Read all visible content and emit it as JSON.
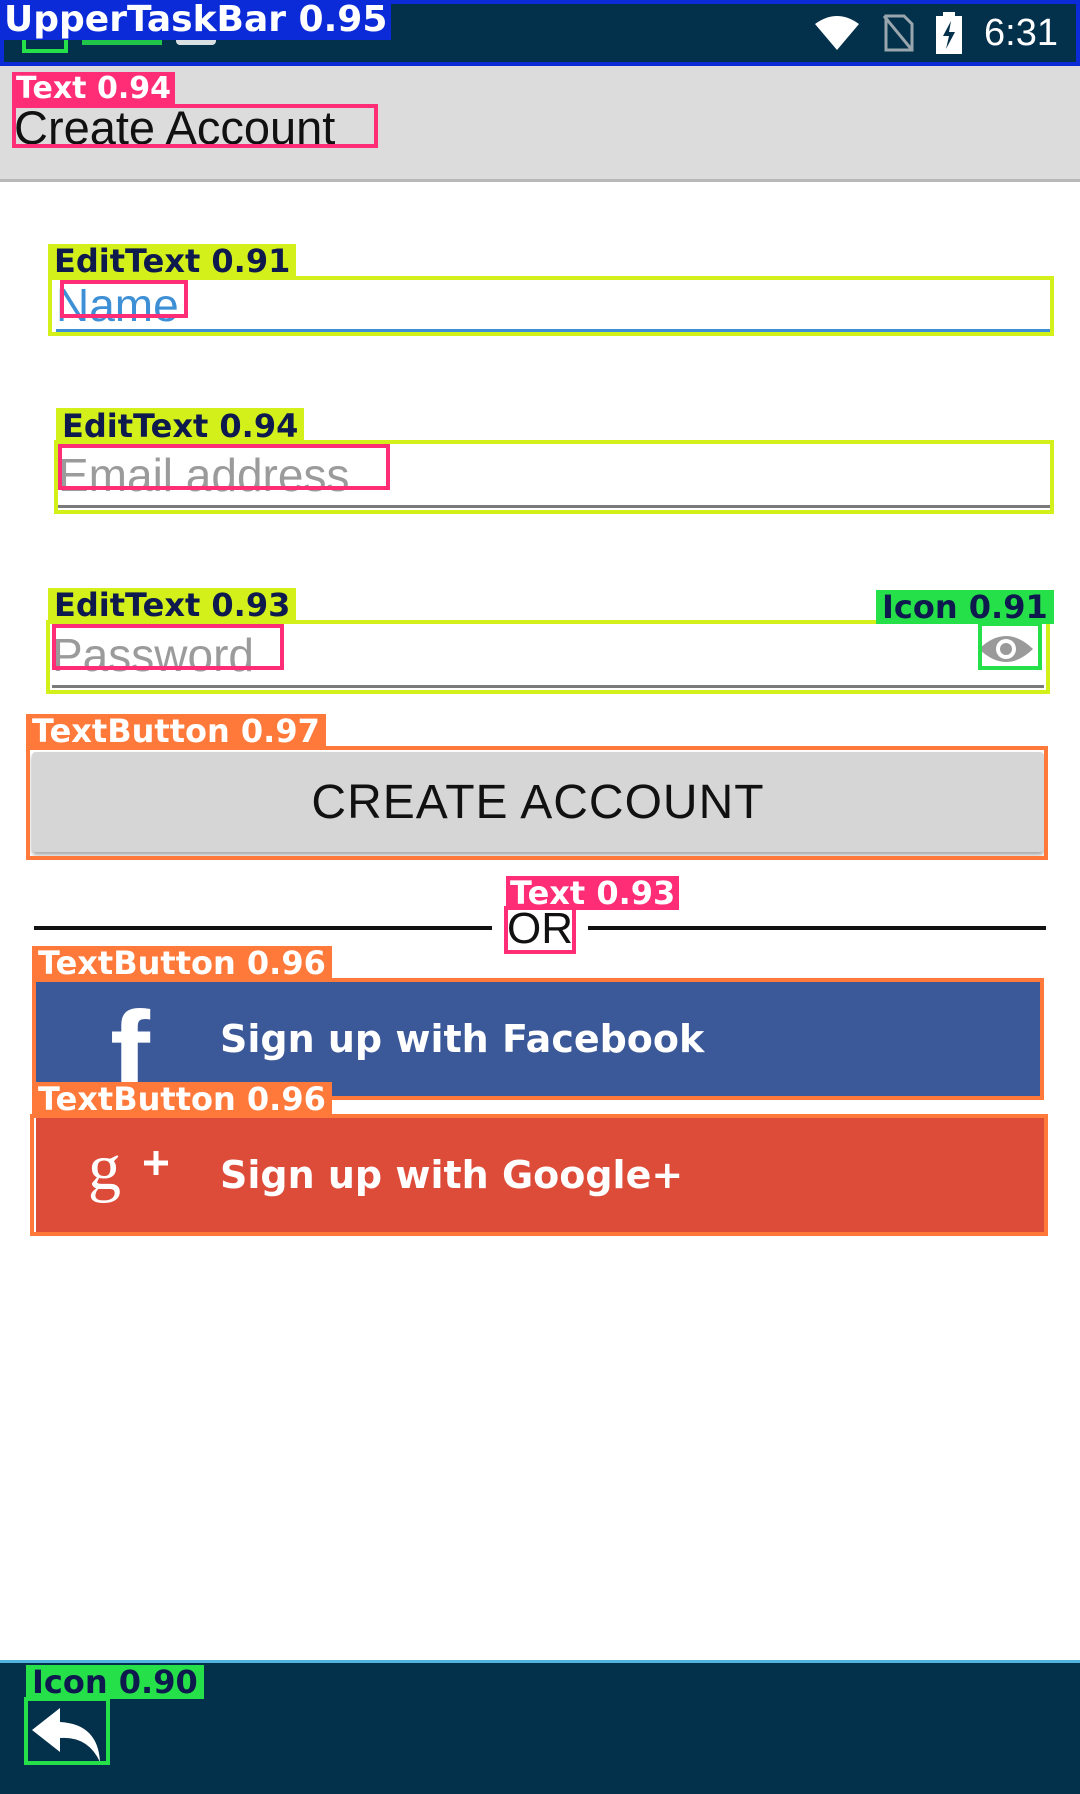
{
  "status_bar": {
    "time": "6:31",
    "icons": [
      "wifi-icon",
      "no-sim-icon",
      "battery-charging-icon"
    ],
    "overlay_label": "UpperTaskBar 0.95"
  },
  "header": {
    "title": "Create Account",
    "overlay_label": "Text 0.94"
  },
  "form": {
    "name": {
      "placeholder": "Name",
      "value": "",
      "overlay_label": "EditText 0.91"
    },
    "email": {
      "placeholder": "Email address",
      "value": "",
      "overlay_label": "EditText 0.94"
    },
    "password": {
      "placeholder": "Password",
      "value": "",
      "overlay_label": "EditText 0.93",
      "toggle_icon": "eye-icon",
      "toggle_overlay_label": "Icon 0.91"
    }
  },
  "create_button": {
    "label": "CREATE ACCOUNT",
    "overlay_label": "TextButton 0.97"
  },
  "divider": {
    "text": "OR",
    "overlay_label": "Text 0.93"
  },
  "social": {
    "facebook": {
      "label": "Sign up with Facebook",
      "icon": "facebook-icon",
      "color": "#3b5998",
      "overlay_label": "TextButton 0.96"
    },
    "google": {
      "label": "Sign up with Google+",
      "icon": "google-plus-icon",
      "color": "#dd4b39",
      "overlay_label": "TextButton 0.96"
    }
  },
  "bottom_bar": {
    "back_icon": "back-arrow-icon",
    "overlay_label": "Icon 0.90"
  },
  "colors": {
    "status_bar": "#03304a",
    "header_bg": "#dcdcdc",
    "accent_blue": "#3d8fd6",
    "box_text": "#ff2d75",
    "box_edittext": "#d4f01a",
    "box_button": "#ff7a3a",
    "box_icon": "#26e04a",
    "box_taskbar": "#0b2bd8"
  }
}
